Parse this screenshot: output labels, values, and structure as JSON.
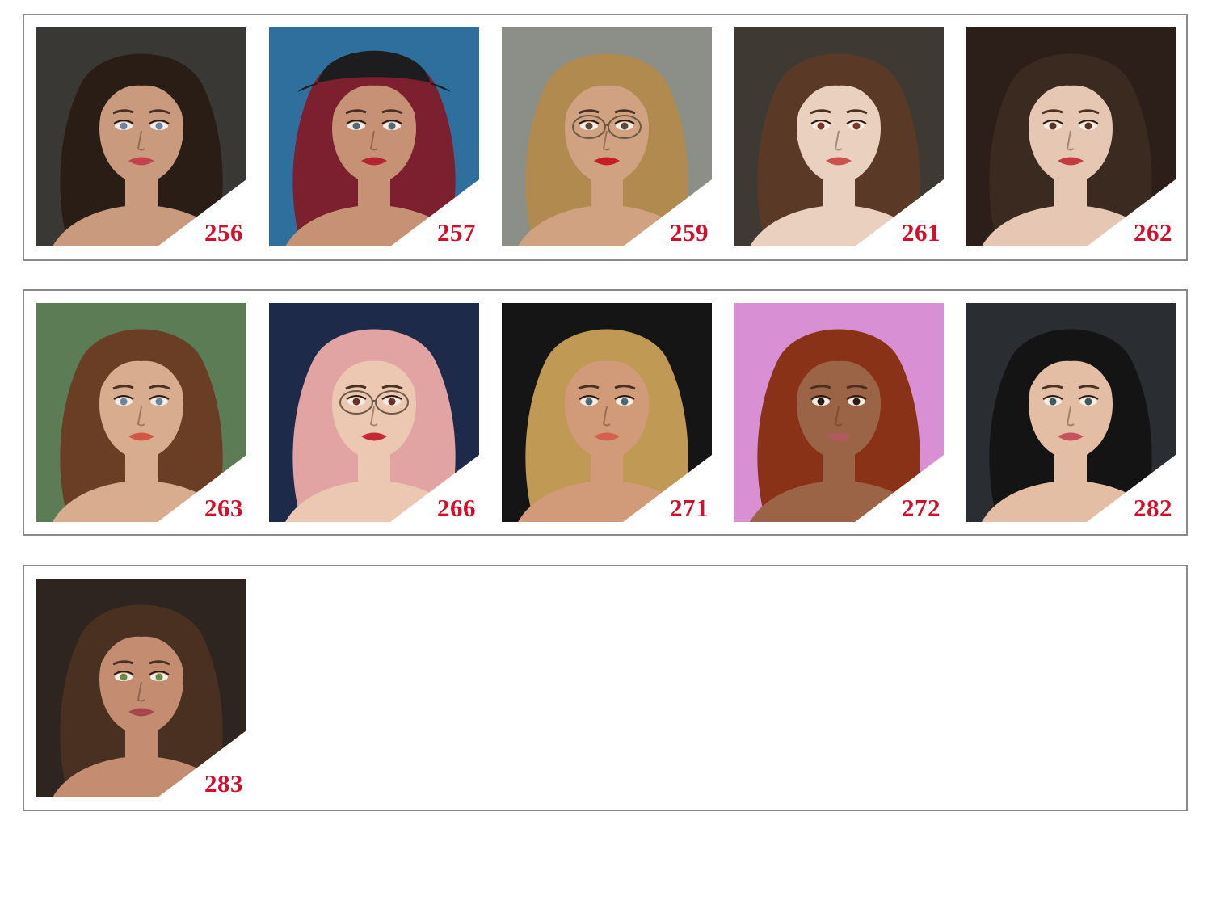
{
  "rows": [
    {
      "items": [
        {
          "number": "256",
          "bg": "#3a3835",
          "hair": "#2a1d16",
          "skin": "#c99a7e",
          "lips": "#c2434b",
          "eyes": "#6d83a8"
        },
        {
          "number": "257",
          "bg": "#2f6f9e",
          "hair": "#7c1f2e",
          "skin": "#c79176",
          "lips": "#b3252f",
          "eyes": "#4f6a78",
          "hat": "#1d1d1f"
        },
        {
          "number": "259",
          "bg": "#8c8f88",
          "hair": "#b08a4f",
          "skin": "#d1a282",
          "lips": "#c51d25",
          "eyes": "#5d4a38",
          "glasses": true
        },
        {
          "number": "261",
          "bg": "#3e3a33",
          "hair": "#5a3a26",
          "skin": "#ead0bf",
          "lips": "#c9524d",
          "eyes": "#7a3a2b"
        },
        {
          "number": "262",
          "bg": "#2c1f1a",
          "hair": "#3a2a20",
          "skin": "#e6c7b3",
          "lips": "#c23b40",
          "eyes": "#5a3426"
        }
      ]
    },
    {
      "items": [
        {
          "number": "263",
          "bg": "#5c7c56",
          "hair": "#6a3e24",
          "skin": "#d8ad8f",
          "lips": "#d25746",
          "eyes": "#6b86a3"
        },
        {
          "number": "266",
          "bg": "#1d2a4a",
          "hair": "#e2a3a3",
          "skin": "#ecc7b1",
          "lips": "#c42a33",
          "eyes": "#6a2f26",
          "glasses": true
        },
        {
          "number": "271",
          "bg": "#151515",
          "hair": "#c09a55",
          "skin": "#d19a79",
          "lips": "#d4614f",
          "eyes": "#4a6b74"
        },
        {
          "number": "272",
          "bg": "#d98fd3",
          "hair": "#8a3217",
          "skin": "#9c6446",
          "lips": "#b05a5e",
          "eyes": "#2c1c16"
        },
        {
          "number": "282",
          "bg": "#2a2e33",
          "hair": "#141414",
          "skin": "#e4bda5",
          "lips": "#c4545d",
          "eyes": "#3b5a5c"
        }
      ]
    },
    {
      "items": [
        {
          "number": "283",
          "bg": "#2e2520",
          "hair": "#4a3020",
          "skin": "#c48d71",
          "lips": "#a8454b",
          "eyes": "#6c8a46"
        }
      ]
    }
  ],
  "colors": {
    "label": "#d3102c",
    "border": "#8a8a8a"
  }
}
